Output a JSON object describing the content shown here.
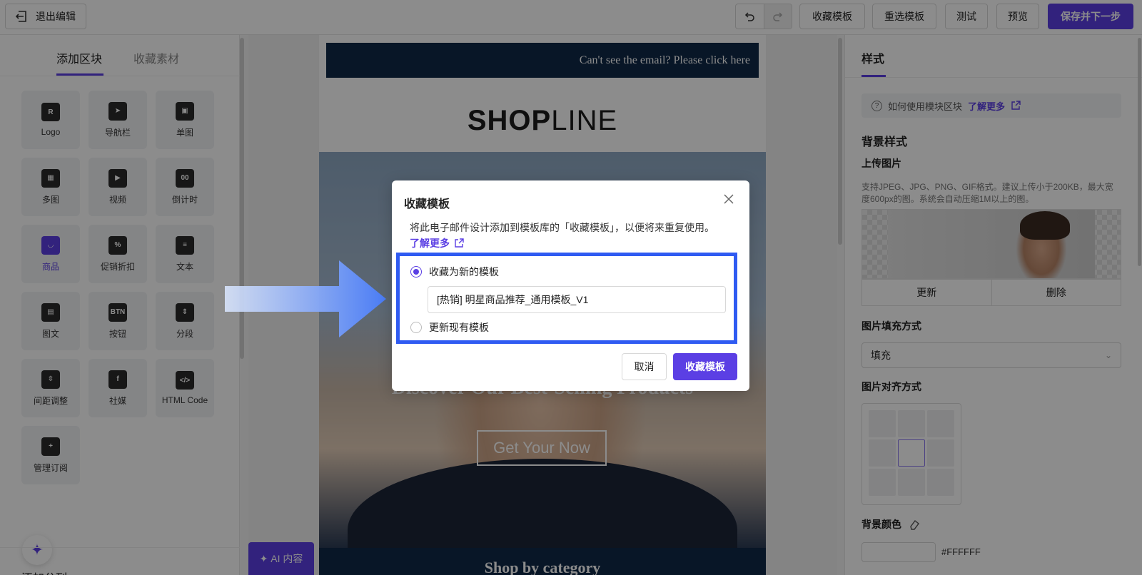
{
  "topbar": {
    "exit_label": "退出编辑",
    "buttons": [
      "收藏模板",
      "重选模板",
      "测试",
      "预览"
    ],
    "primary_label": "保存并下一步"
  },
  "left": {
    "tab_active": "添加区块",
    "tab_inactive": "收藏素材",
    "blocks": [
      {
        "label": "Logo",
        "icon": "logo-icon"
      },
      {
        "label": "导航栏",
        "icon": "navigation-icon"
      },
      {
        "label": "单图",
        "icon": "image-icon"
      },
      {
        "label": "多图",
        "icon": "multi-image-icon"
      },
      {
        "label": "视频",
        "icon": "video-icon"
      },
      {
        "label": "倒计时",
        "icon": "countdown-icon"
      },
      {
        "label": "商品",
        "icon": "product-bag-icon"
      },
      {
        "label": "促销折扣",
        "icon": "discount-tag-icon"
      },
      {
        "label": "文本",
        "icon": "text-icon"
      },
      {
        "label": "图文",
        "icon": "image-text-icon"
      },
      {
        "label": "按钮",
        "icon": "button-icon",
        "glyph": "BTN"
      },
      {
        "label": "分段",
        "icon": "divider-icon"
      },
      {
        "label": "间距调整",
        "icon": "spacing-icon"
      },
      {
        "label": "社媒",
        "icon": "social-icon",
        "glyph": "f"
      },
      {
        "label": "HTML Code",
        "icon": "code-icon"
      },
      {
        "label": "管理订阅",
        "icon": "subscribe-icon"
      }
    ],
    "add_column": "添加分列",
    "ai_button": "AI 内容"
  },
  "email": {
    "topbar_text": "Can't see the email? Please click here",
    "logo_bold": "SHOP",
    "logo_light": "LINE",
    "hero_title": "Discover Our Best-Selling Products",
    "hero_button": "Get Your Now",
    "category_title": "Shop by category"
  },
  "right": {
    "tab": "样式",
    "help_text": "如何使用模块区块",
    "help_link": "了解更多",
    "bg_style": "背景样式",
    "upload": "上传图片",
    "upload_note": "支持JPEG、JPG、PNG、GIF格式。建议上传小于200KB，最大宽度600px的图。系统会自动压缩1M以上的图。",
    "update_btn": "更新",
    "delete_btn": "删除",
    "fill_label": "图片填充方式",
    "fill_value": "填充",
    "align_label": "图片对齐方式",
    "bg_color_label": "背景颜色",
    "bg_color_value": "#FFFFFF"
  },
  "modal": {
    "title": "收藏模板",
    "description": "将此电子邮件设计添加到模板库的「收藏模板」，以便将来重复使用。",
    "learn_more": "了解更多",
    "option_new": "收藏为新的模板",
    "option_update": "更新现有模板",
    "template_name": "[热销] 明星商品推荐_通用模板_V1",
    "cancel": "取消",
    "confirm": "收藏模板"
  },
  "colors": {
    "accent": "#5b3fe4",
    "highlight_border": "#2f5bf2",
    "email_navy": "#0f2847"
  }
}
